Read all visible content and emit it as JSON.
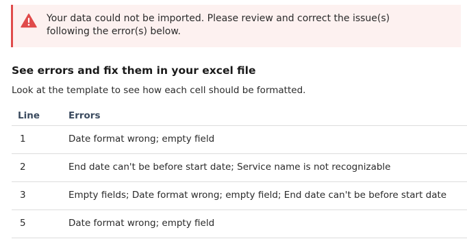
{
  "alert": {
    "icon": "warning-triangle-icon",
    "color": "#e04b4b",
    "background": "#fdf1f0",
    "line1": "Your data could not be imported. Please review and correct the issue(s)",
    "line2": "following the error(s) below."
  },
  "section": {
    "heading": "See errors and fix them in your excel file",
    "description": "Look at the template to see how each cell should be formatted."
  },
  "table": {
    "columns": [
      "Line",
      "Errors"
    ],
    "rows": [
      {
        "line": "1",
        "errors": "Date format wrong; empty field"
      },
      {
        "line": "2",
        "errors": "End date can't be before start date; Service name is not recognizable"
      },
      {
        "line": "3",
        "errors": "Empty fields; Date format wrong; empty field; End date can't be before start date"
      },
      {
        "line": "5",
        "errors": "Date format wrong; empty field"
      }
    ]
  }
}
